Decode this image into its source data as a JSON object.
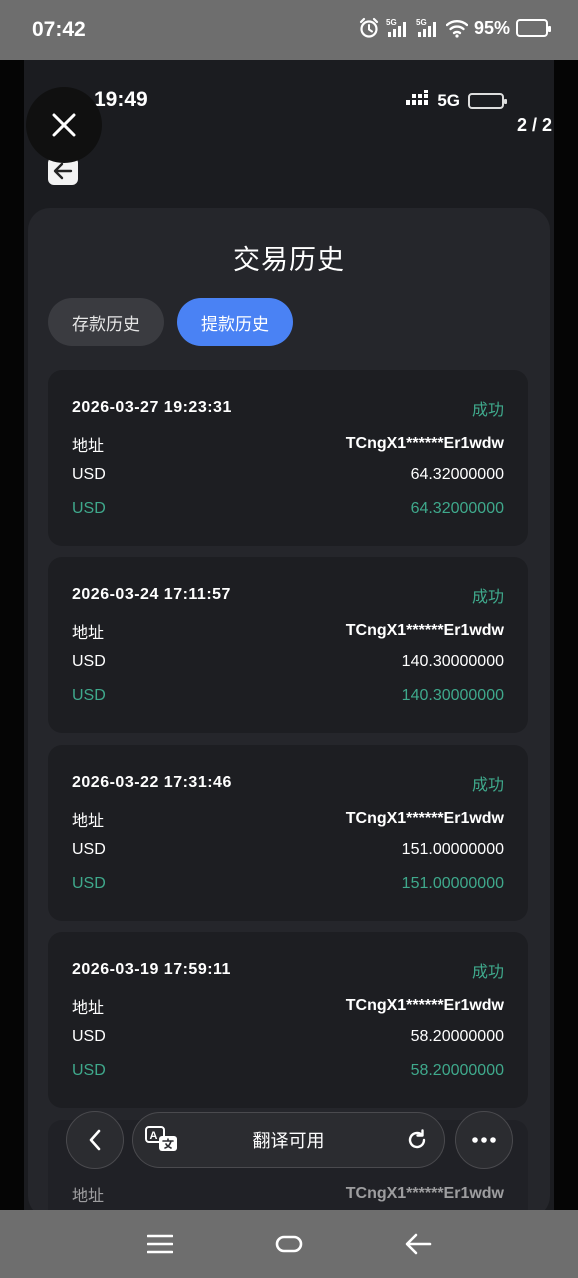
{
  "system_status": {
    "time": "07:42",
    "signal1_label": "5G",
    "signal2_label": "5G",
    "battery_percent": "95%",
    "battery_level": 0.95
  },
  "viewer": {
    "page_counter": "2 / 2",
    "close_icon": "close-icon"
  },
  "screenshot": {
    "status": {
      "time": "19:49",
      "network": "5G",
      "battery_color": "#e23b3b"
    },
    "page_title": "交易历史",
    "tabs": [
      {
        "label": "存款历史",
        "active": false
      },
      {
        "label": "提款历史",
        "active": true
      }
    ],
    "records": [
      {
        "datetime": "2026-03-27 19:23:31",
        "status": "成功",
        "addr_label": "地址",
        "address": "TCngX1******Er1wdw",
        "currency": "USD",
        "amount": "64.32000000",
        "net_currency": "USD",
        "net_amount": "64.32000000"
      },
      {
        "datetime": "2026-03-24 17:11:57",
        "status": "成功",
        "addr_label": "地址",
        "address": "TCngX1******Er1wdw",
        "currency": "USD",
        "amount": "140.30000000",
        "net_currency": "USD",
        "net_amount": "140.30000000"
      },
      {
        "datetime": "2026-03-22 17:31:46",
        "status": "成功",
        "addr_label": "地址",
        "address": "TCngX1******Er1wdw",
        "currency": "USD",
        "amount": "151.00000000",
        "net_currency": "USD",
        "net_amount": "151.00000000"
      },
      {
        "datetime": "2026-03-19 17:59:11",
        "status": "成功",
        "addr_label": "地址",
        "address": "TCngX1******Er1wdw",
        "currency": "USD",
        "amount": "58.20000000",
        "net_currency": "USD",
        "net_amount": "58.20000000"
      }
    ],
    "partial_record": {
      "addr_label": "地址",
      "address": "TCngX1******Er1wdw"
    }
  },
  "toolbar": {
    "translate_label": "翻译可用"
  },
  "colors": {
    "accent": "#4a82f4",
    "success": "#3fa98c",
    "card_bg": "#25262b",
    "record_bg": "#1d1e22"
  }
}
